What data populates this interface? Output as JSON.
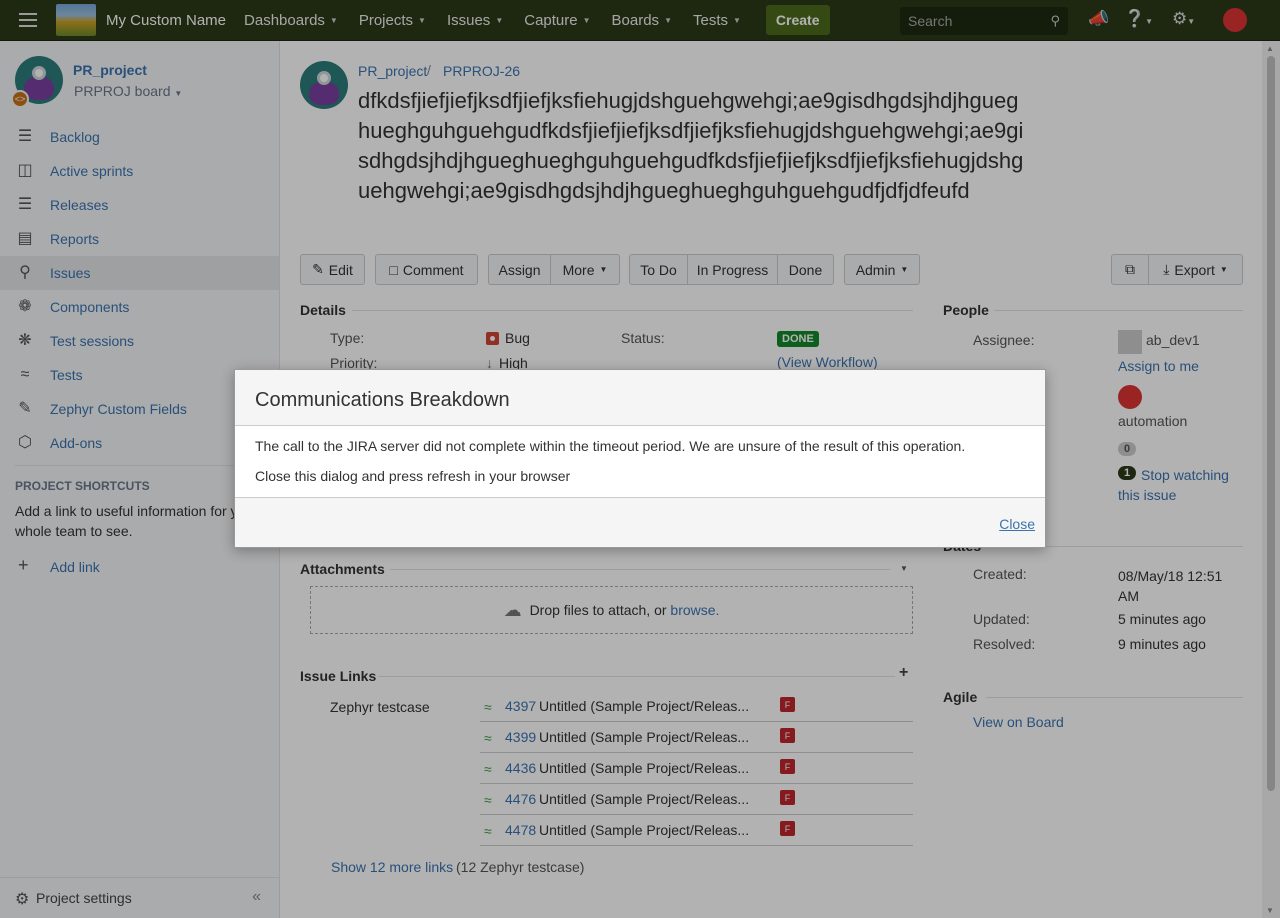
{
  "topnav": {
    "brand": "My Custom Name",
    "menu": [
      "Dashboards",
      "Projects",
      "Issues",
      "Capture",
      "Boards",
      "Tests"
    ],
    "create": "Create",
    "search_placeholder": "Search"
  },
  "sidebar": {
    "project_name": "PR_project",
    "board": "PRPROJ board",
    "items": [
      {
        "label": "Backlog",
        "icon": "backlog-icon"
      },
      {
        "label": "Active sprints",
        "icon": "sprints-icon"
      },
      {
        "label": "Releases",
        "icon": "releases-icon"
      },
      {
        "label": "Reports",
        "icon": "reports-icon"
      },
      {
        "label": "Issues",
        "icon": "issues-icon"
      },
      {
        "label": "Components",
        "icon": "components-icon"
      },
      {
        "label": "Test sessions",
        "icon": "test-sessions-icon"
      },
      {
        "label": "Tests",
        "icon": "tests-icon"
      },
      {
        "label": "Zephyr Custom Fields",
        "icon": "zephyr-icon"
      },
      {
        "label": "Add-ons",
        "icon": "addons-icon"
      }
    ],
    "shortcuts_heading": "PROJECT SHORTCUTS",
    "shortcuts_text": "Add a link to useful information for your whole team to see.",
    "add_link": "Add link",
    "project_settings": "Project settings"
  },
  "issue": {
    "breadcrumb_project": "PR_project",
    "breadcrumb_key": "PRPROJ-26",
    "summary": "dfkdsfjiefjiefjksdfjiefjksfiehugjdshguehgwehgi;ae9gisdhgdsjhdjhgueghueghguhguehgudfkdsfjiefjiefjksdfjiefjksfiehugjdshguehgwehgi;ae9gisdhgdsjhdjhgueghueghguhguehgudfkdsfjiefjiefjksdfjiefjksfiehugjdshguehgwehgi;ae9gisdhgdsjhdjhgueghueghguhguehgudfjdfjdfeufd"
  },
  "toolbar": {
    "edit": "Edit",
    "comment": "Comment",
    "assign": "Assign",
    "more": "More",
    "todo": "To Do",
    "inprogress": "In Progress",
    "done": "Done",
    "admin": "Admin",
    "export": "Export"
  },
  "details": {
    "heading": "Details",
    "type_label": "Type:",
    "type_value": "Bug",
    "status_label": "Status:",
    "status_value": "DONE",
    "view_workflow": "(View Workflow)",
    "priority_label": "Priority:",
    "priority_value": "High"
  },
  "people": {
    "heading": "People",
    "assignee_label": "Assignee:",
    "assignee_value": "ab_dev1",
    "assign_to_me": "Assign to me",
    "reporter_value": "automation",
    "votes": "0",
    "watchers": "1",
    "stop_watching": "Stop watching this issue"
  },
  "dates": {
    "heading": "Dates",
    "created_label": "Created:",
    "created_value": "08/May/18 12:51 AM",
    "updated_label": "Updated:",
    "updated_value": "5 minutes ago",
    "resolved_label": "Resolved:",
    "resolved_value": "9 minutes ago"
  },
  "agile": {
    "heading": "Agile",
    "view_on_board": "View on Board"
  },
  "attachments": {
    "heading": "Attachments",
    "drop_text": "Drop files to attach, or",
    "browse": "browse."
  },
  "issue_links": {
    "heading": "Issue Links",
    "type": "Zephyr testcase",
    "rows": [
      {
        "key": "4397",
        "title": "Untitled (Sample Project/Releas...",
        "badge": "F"
      },
      {
        "key": "4399",
        "title": "Untitled (Sample Project/Releas...",
        "badge": "F"
      },
      {
        "key": "4436",
        "title": "Untitled (Sample Project/Releas...",
        "badge": "F"
      },
      {
        "key": "4476",
        "title": "Untitled (Sample Project/Releas...",
        "badge": "F"
      },
      {
        "key": "4478",
        "title": "Untitled (Sample Project/Releas...",
        "badge": "F"
      }
    ],
    "show_more": "Show 12 more links",
    "show_more_suffix": "(12 Zephyr testcase)"
  },
  "dialog": {
    "title": "Communications Breakdown",
    "message1": "The call to the JIRA server did not complete within the timeout period. We are unsure of the result of this operation.",
    "message2": "Close this dialog and press refresh in your browser",
    "close": "Close"
  }
}
